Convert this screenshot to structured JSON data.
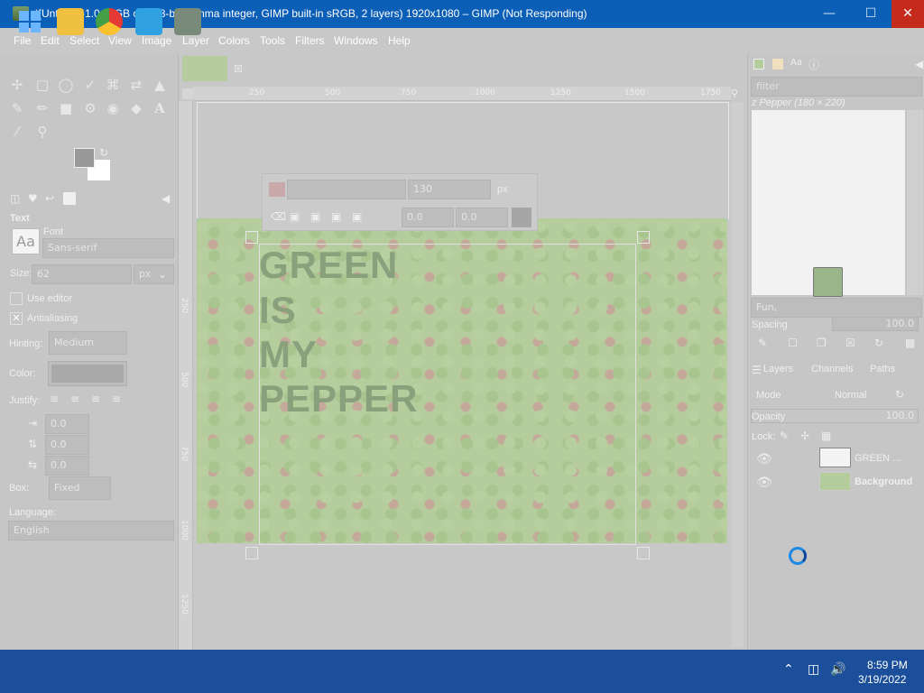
{
  "window": {
    "title": "*[Untitled]-1.0 (RGB color 8-bit gamma integer, GIMP built-in sRGB, 2 layers) 1920x1080 – GIMP (Not Responding)"
  },
  "menu": [
    "File",
    "Edit",
    "Select",
    "View",
    "Image",
    "Layer",
    "Colors",
    "Tools",
    "Filters",
    "Windows",
    "Help"
  ],
  "tool_options": {
    "panel_title": "Text",
    "font_label": "Font",
    "font_value": "Sans-serif",
    "font_preview": "Aa",
    "size_label": "Size:",
    "size_value": "62",
    "size_unit": "px",
    "use_editor": "Use editor",
    "antialiasing": "Antialiasing",
    "hinting_label": "Hinting:",
    "hinting_value": "Medium",
    "color_label": "Color:",
    "justify_label": "Justify:",
    "indent_value": "0.0",
    "line_spacing_value": "0.0",
    "letter_spacing_value": "0.0",
    "box_label": "Box:",
    "box_value": "Fixed",
    "language_label": "Language:",
    "language_value": "English"
  },
  "rulers": {
    "h_ticks": [
      "250",
      "500",
      "750",
      "1000",
      "1250",
      "1500",
      "1750"
    ],
    "v_ticks": [
      "250",
      "500",
      "750",
      "1000",
      "1250"
    ]
  },
  "text_toolbar": {
    "size_value": "130",
    "size_unit": "px",
    "baseline": "0.0",
    "kerning": "0.0"
  },
  "canvas_text": [
    "GREEN",
    "IS",
    "MY",
    "PEPPER"
  ],
  "brushes": {
    "filter_placeholder": "filter",
    "current": "z Pepper (180 × 220)",
    "tag": "Fun,",
    "spacing_label": "Spacing",
    "spacing_value": "100.0"
  },
  "layers": {
    "tabs": [
      "Layers",
      "Channels",
      "Paths"
    ],
    "mode_label": "Mode",
    "mode_value": "Normal",
    "opacity_label": "Opacity",
    "opacity_value": "100.0",
    "lock_label": "Lock:",
    "items": [
      {
        "name": "GREEN ..."
      },
      {
        "name": "Background"
      }
    ]
  },
  "taskbar": {
    "time": "8:59 PM",
    "date": "3/19/2022"
  },
  "colors": {
    "titlebar": "#0b5fb7",
    "close": "#c42b1c",
    "taskbar": "#1b4f9c"
  }
}
